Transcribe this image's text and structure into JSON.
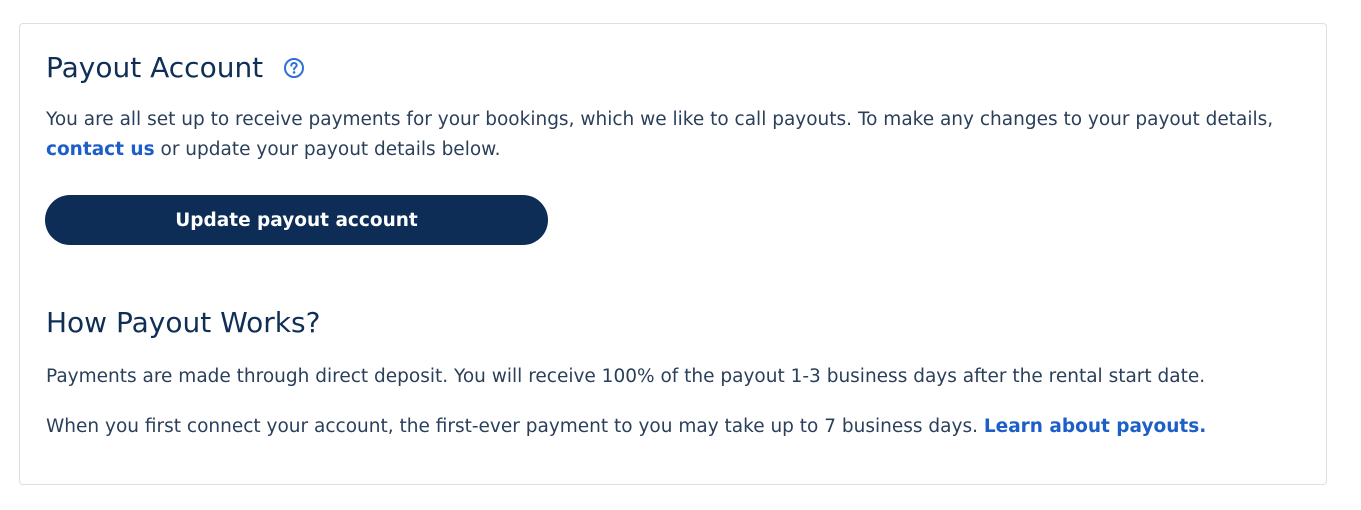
{
  "payout_account": {
    "title": "Payout Account",
    "help_icon": "question-circle-icon",
    "intro_text_before_link": "You are all set up to receive payments for your bookings, which we like to call payouts. To make any changes to your payout details,",
    "contact_link": "contact us",
    "intro_text_after_link": "or update your payout details below.",
    "update_button_label": "Update payout account"
  },
  "how_payout_works": {
    "title": "How Payout Works?",
    "paragraph_1": "Payments are made through direct deposit. You will receive 100% of the payout 1-3 business days after the rental start date.",
    "paragraph_2_text": "When you first connect your account, the first-ever payment to you may take up to 7 business days.",
    "learn_link": "Learn about payouts."
  },
  "colors": {
    "heading": "#0f2f55",
    "body_text": "#2a3f5a",
    "link": "#1d5fc8",
    "button_bg": "#0d2d57",
    "button_text": "#ffffff",
    "card_border": "#dcdfe4"
  }
}
